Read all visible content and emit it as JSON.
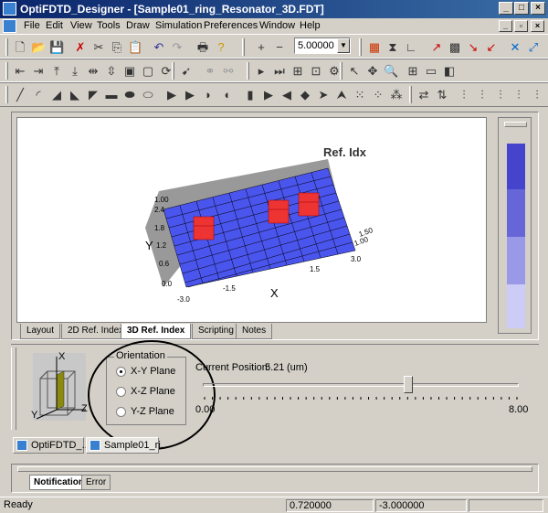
{
  "window": {
    "title": "OptiFDTD_Designer - [Sample01_ring_Resonator_3D.FDT]",
    "minimize": "_",
    "maximize": "□",
    "close": "×"
  },
  "menu": [
    "File",
    "Edit",
    "View",
    "Tools",
    "Draw",
    "Simulation",
    "Preferences",
    "Window",
    "Help"
  ],
  "toolbar": {
    "zoom_value": "5.00000"
  },
  "chart": {
    "title": "Ref. Idx",
    "xlabel": "X",
    "ylabel": "Y",
    "x_ticks": [
      "-3.0",
      "-1.5",
      "1.5",
      "3.0"
    ],
    "y_ticks": [
      "0.0",
      "0.6",
      "1.2",
      "1.8",
      "2.4"
    ],
    "z_ticks": [
      "1.00",
      "1.50"
    ],
    "top_left_label": "1.00"
  },
  "tabs": [
    "Layout",
    "2D Ref. Index",
    "3D Ref. Index",
    "Scripting",
    "Notes"
  ],
  "active_tab": "3D Ref. Index",
  "orientation": {
    "legend": "Orientation",
    "options": [
      "X-Y Plane",
      "X-Z Plane",
      "Y-Z Plane"
    ],
    "selected": "X-Y Plane"
  },
  "plane_axes": {
    "x": "X",
    "y": "Y",
    "z": "Z"
  },
  "position": {
    "label": "Current Position:",
    "value": "5.21",
    "unit": "(um)",
    "min": "0.00",
    "max": "8.00",
    "fraction": 0.651
  },
  "doc_tabs": [
    "OptiFDTD_...",
    "Sample01_ri..."
  ],
  "notify_tabs": [
    "Notification",
    "Error"
  ],
  "status": {
    "text": "Ready",
    "x": "0.720000",
    "y": "-3.000000"
  },
  "colors": {
    "titlebar": "#0a246a",
    "grid_blue": "#4a55ee",
    "block_red": "#ee3333",
    "legend_blue": "#4444cc"
  }
}
